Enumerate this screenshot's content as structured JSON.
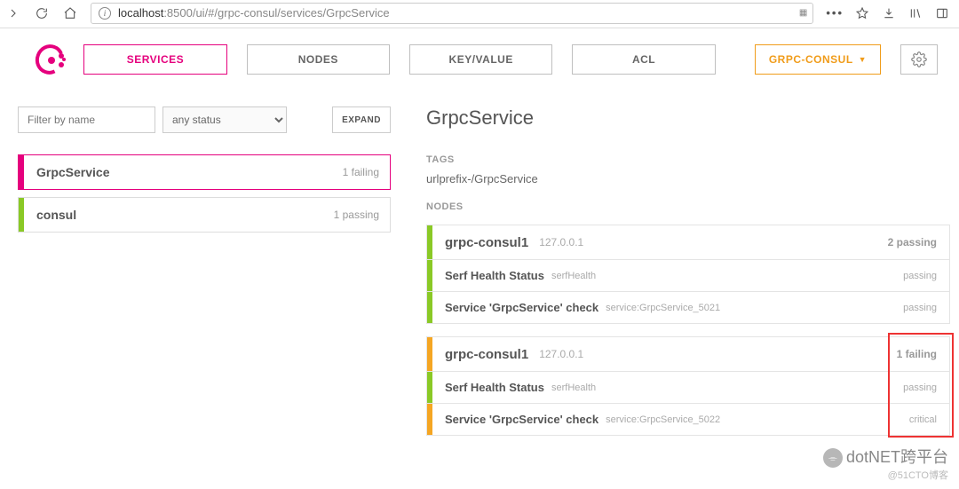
{
  "browser": {
    "url_pre": "localhost",
    "url_post": ":8500/ui/#/grpc-consul/services/GrpcService"
  },
  "tabs": {
    "services": "SERVICES",
    "nodes": "NODES",
    "kv": "KEY/VALUE",
    "acl": "ACL",
    "dc": "GRPC-CONSUL"
  },
  "filter": {
    "placeholder": "Filter by name",
    "status": "any status",
    "expand": "EXPAND"
  },
  "services": [
    {
      "name": "GrpcService",
      "stat": "1 failing",
      "selected": true,
      "bar": "pink"
    },
    {
      "name": "consul",
      "stat": "1 passing",
      "selected": false,
      "bar": "green"
    }
  ],
  "detail": {
    "title": "GrpcService",
    "tags_label": "TAGS",
    "tags_value": "urlprefix-/GrpcService",
    "nodes_label": "NODES",
    "nodes": [
      {
        "name": "grpc-consul1",
        "ip": "127.0.0.1",
        "stat": "2 passing",
        "bar": "green",
        "checks": [
          {
            "name": "Serf Health Status",
            "id": "serfHealth",
            "stat": "passing",
            "bar": "green"
          },
          {
            "name": "Service 'GrpcService' check",
            "id": "service:GrpcService_5021",
            "stat": "passing",
            "bar": "green"
          }
        ]
      },
      {
        "name": "grpc-consul1",
        "ip": "127.0.0.1",
        "stat": "1 failing",
        "bar": "orange",
        "highlight": true,
        "checks": [
          {
            "name": "Serf Health Status",
            "id": "serfHealth",
            "stat": "passing",
            "bar": "green"
          },
          {
            "name": "Service 'GrpcService' check",
            "id": "service:GrpcService_5022",
            "stat": "critical",
            "bar": "orange"
          }
        ]
      }
    ]
  },
  "watermark": {
    "main": "dotNET跨平台",
    "sub": "@51CTO博客"
  }
}
